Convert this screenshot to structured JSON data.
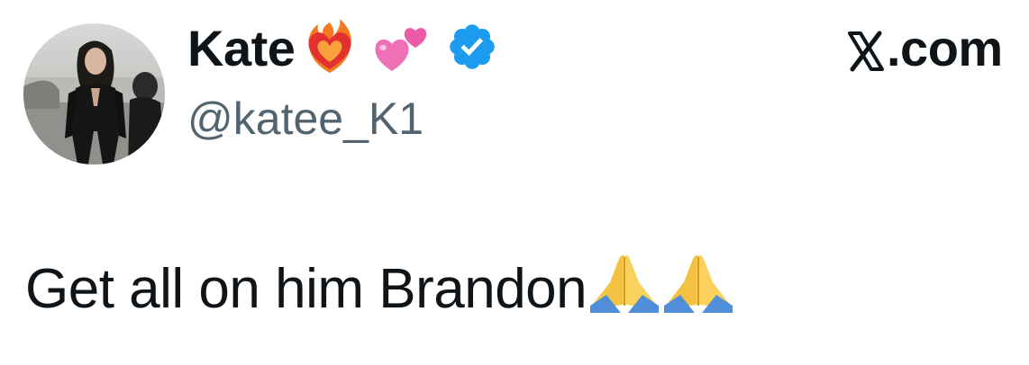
{
  "profile": {
    "display_name": "Kate",
    "handle": "@katee_K1",
    "name_emojis": [
      "heart-on-fire-icon",
      "two-hearts-icon"
    ],
    "verified": true
  },
  "site_label": ".com",
  "site_logo": "x-logo-icon",
  "tweet": {
    "text": "Get all on him Brandon",
    "trailing_emojis": [
      "folded-hands-icon",
      "folded-hands-icon"
    ]
  },
  "colors": {
    "text": "#0f1419",
    "handle": "#536471",
    "verified_badge": "#1d9bf0",
    "background": "#ffffff"
  }
}
